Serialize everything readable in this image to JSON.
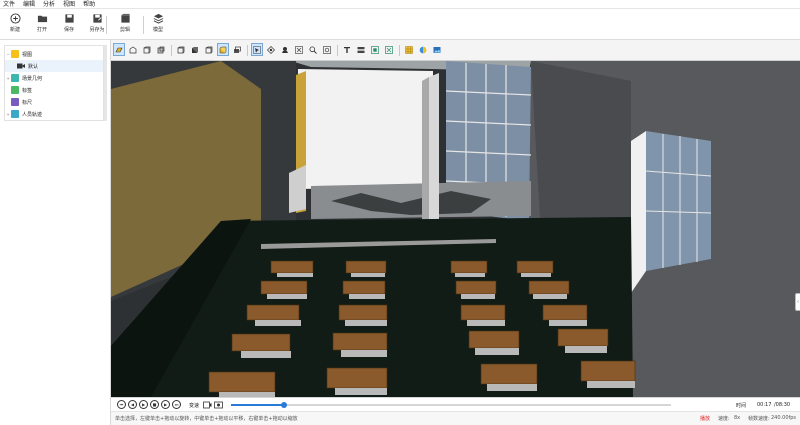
{
  "menu": [
    "文件",
    "编辑",
    "分析",
    "视图",
    "帮助"
  ],
  "toolbar": {
    "new": "新建",
    "open": "打开",
    "save": "保存",
    "save_as": "另存为",
    "clip": "剪辑",
    "model": "模型"
  },
  "tree": {
    "items": [
      {
        "label": "视图",
        "icon": "view-folder-icon",
        "color": "#f5c21a",
        "expanded": true
      },
      {
        "label": "默认",
        "icon": "camera-icon",
        "color": "#444444",
        "selected": true
      },
      {
        "label": "场景几何",
        "icon": "geometry-icon",
        "color": "#3bb7b0"
      },
      {
        "label": "标签",
        "icon": "tag-icon",
        "color": "#4bb865"
      },
      {
        "label": "标尺",
        "icon": "ruler-icon",
        "color": "#7a5bbf"
      },
      {
        "label": "人员轨迹",
        "icon": "people-icon",
        "color": "#3aa6c8"
      }
    ]
  },
  "playback": {
    "speed_label": "变速",
    "time_label": "时间",
    "current_time": "00:17",
    "total_time": "/08:30",
    "progress": 0.12
  },
  "status": {
    "hint": "单击选择，左键单击+拖动以旋转，中键单击+拖动以平移，右键单击+拖动以缩放",
    "state": "播放",
    "speed_label": "速度:",
    "speed_value": "8x",
    "fps_label": "帧数速度:",
    "fps_value": "240.00fps"
  },
  "colors": {
    "accent": "#2a7bd8",
    "state_red": "#e02020",
    "bench_wood": "#8a5a2c",
    "floor": "#101c15"
  }
}
